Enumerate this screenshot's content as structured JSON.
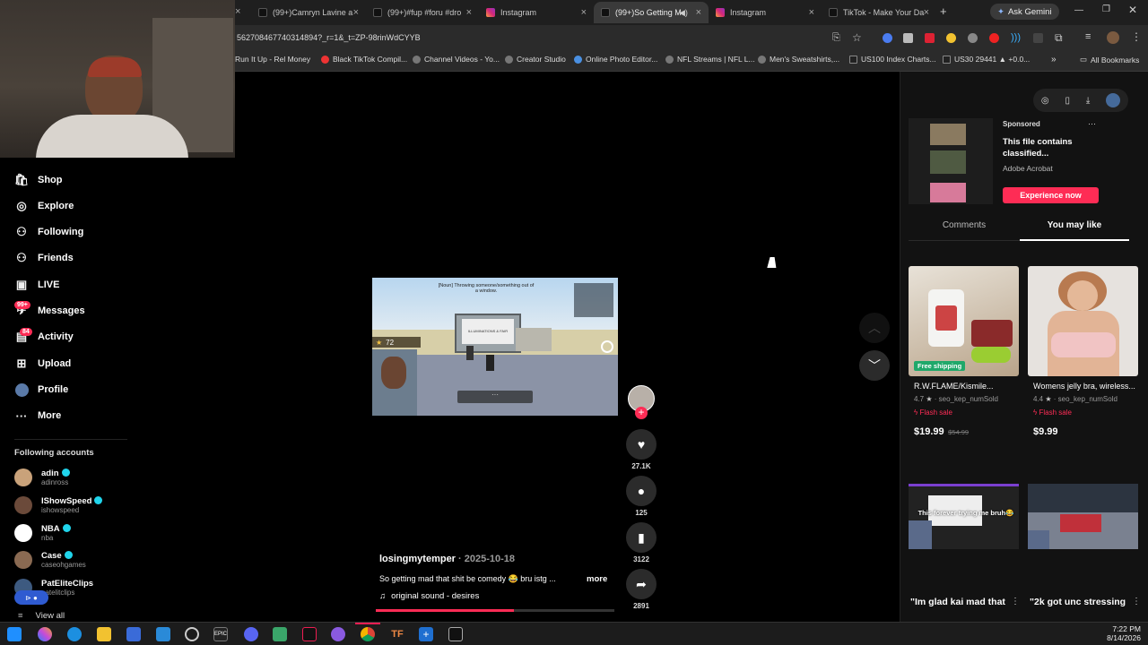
{
  "browser": {
    "tabs": [
      {
        "label": "(99+)Camryn Lavine a",
        "active": false
      },
      {
        "label": "(99+)#fup #foru #dro",
        "active": false
      },
      {
        "label": "Instagram",
        "active": false
      },
      {
        "label": "(99+)So Getting M",
        "active": true
      },
      {
        "label": "Instagram",
        "active": false
      },
      {
        "label": "TikTok - Make Your Da",
        "active": false
      }
    ],
    "new_tab": "+",
    "ask_gemini": "Ask Gemini",
    "url": "562708467740314894?_r=1&_t=ZP-98rinWdCYYB",
    "bookmarks": [
      "Run It Up - Rel Money",
      "Black TikTok Compil...",
      "Channel Videos - Yo...",
      "Creator Studio",
      "Online Photo Editor...",
      "NFL Streams | NFL L...",
      "Men's Sweatshirts,...",
      "US100 Index Charts...",
      "US30 29441 ▲ +0.0..."
    ],
    "all_bookmarks": "All Bookmarks"
  },
  "sidebar": {
    "items": [
      {
        "label": "Shop",
        "icon": "shop-icon"
      },
      {
        "label": "Explore",
        "icon": "compass-icon"
      },
      {
        "label": "Following",
        "icon": "person-icon"
      },
      {
        "label": "Friends",
        "icon": "friends-icon"
      },
      {
        "label": "LIVE",
        "icon": "live-icon"
      },
      {
        "label": "Messages",
        "icon": "message-icon",
        "badge": "99+"
      },
      {
        "label": "Activity",
        "icon": "inbox-icon",
        "badge": "84"
      },
      {
        "label": "Upload",
        "icon": "plus-square-icon"
      },
      {
        "label": "Profile",
        "icon": "avatar"
      },
      {
        "label": "More",
        "icon": "more-icon"
      }
    ],
    "following_title": "Following accounts",
    "accounts": [
      {
        "name": "adin",
        "handle": "adinross",
        "color": "#c9a27a"
      },
      {
        "name": "IShowSpeed",
        "handle": "ishowspeed",
        "color": "#6b4a3a"
      },
      {
        "name": "NBA",
        "handle": "nba",
        "color": "#ffffff"
      },
      {
        "name": "Case",
        "handle": "caseohgames",
        "color": "#8a6a52"
      },
      {
        "name": "PatEliteClips",
        "handle": "patelitclips",
        "color": "#3d5a80"
      }
    ],
    "view_all": "View all"
  },
  "video": {
    "overlay_text": "[Noun] Throwing someone/something out of a window.",
    "sign_text": "ILLUMINATIONS & FAIR",
    "star_count": "72",
    "author": "losingmytemper",
    "date": "2025-10-18",
    "caption": "So getting mad that shit be comedy 😂 bru istg ...",
    "more": "more",
    "sound": "original sound - desires",
    "progress": 0.58
  },
  "actions": {
    "likes": "27.1K",
    "comments": "125",
    "saves": "3122",
    "shares": "2891"
  },
  "ad": {
    "sponsored": "Sponsored",
    "title": "This file contains classified...",
    "advertiser": "Adobe Acrobat",
    "cta": "Experience now",
    "menu": "···"
  },
  "panel_tabs": {
    "comments": "Comments",
    "you_may_like": "You may like"
  },
  "products": [
    {
      "badge": "Free shipping",
      "title": "R.W.FLAME/Kismile...",
      "rating": "4.7",
      "sold": "seo_kep_numSold",
      "flash": "Flash sale",
      "price": "$19.99",
      "old_price": "$54.99"
    },
    {
      "badge": "",
      "title": "Womens jelly bra, wireless...",
      "rating": "4.4",
      "sold": "seo_kep_numSold",
      "flash": "Flash sale",
      "price": "$9.99",
      "old_price": ""
    }
  ],
  "related": [
    {
      "overlay": "This forever trying me bruh😂",
      "caption": "\"Im glad kai mad that"
    },
    {
      "overlay": "",
      "caption": "\"2k got unc stressing"
    }
  ],
  "system": {
    "time": "7:22 PM",
    "date": "8/14/2026"
  },
  "colors": {
    "accent": "#fe2c55",
    "bg": "#000000",
    "panel": "#121212"
  }
}
